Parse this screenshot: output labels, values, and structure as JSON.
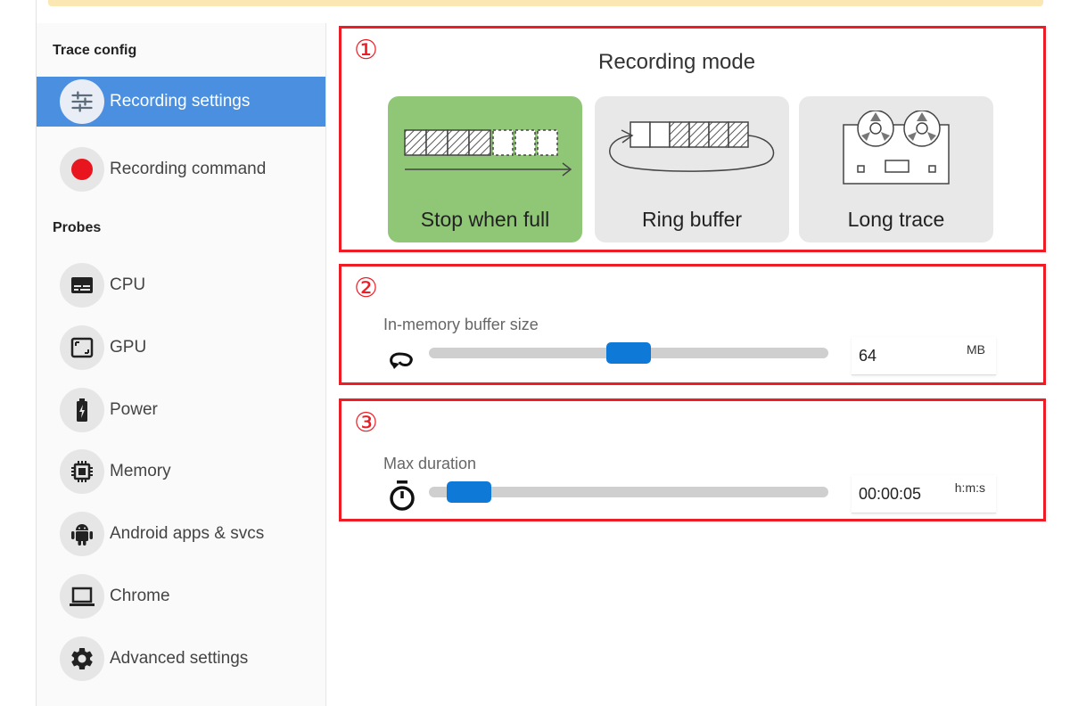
{
  "sidebar": {
    "trace_config_title": "Trace config",
    "probes_title": "Probes",
    "nav": [
      {
        "label": "Recording settings",
        "icon": "sliders-icon",
        "active": true
      },
      {
        "label": "Recording command",
        "icon": "record-dot-icon",
        "active": false
      }
    ],
    "probes": [
      {
        "label": "CPU",
        "icon": "cpu-icon"
      },
      {
        "label": "GPU",
        "icon": "gpu-icon"
      },
      {
        "label": "Power",
        "icon": "battery-icon"
      },
      {
        "label": "Memory",
        "icon": "memory-chip-icon"
      },
      {
        "label": "Android apps & svcs",
        "icon": "android-icon"
      },
      {
        "label": "Chrome",
        "icon": "laptop-icon"
      },
      {
        "label": "Advanced settings",
        "icon": "gear-icon"
      }
    ]
  },
  "annotations": [
    "①",
    "②",
    "③"
  ],
  "recording_mode": {
    "title": "Recording mode",
    "options": [
      {
        "label": "Stop when full",
        "selected": true
      },
      {
        "label": "Ring buffer",
        "selected": false
      },
      {
        "label": "Long trace",
        "selected": false
      }
    ]
  },
  "buffer": {
    "label": "In-memory buffer size",
    "value": "64",
    "unit": "MB",
    "icon": "loop-arrow-icon",
    "slider_level": 0.5
  },
  "duration": {
    "label": "Max duration",
    "value": "00:00:05",
    "unit": "h:m:s",
    "icon": "stopwatch-icon",
    "slider_level": 0.05
  },
  "colors": {
    "accent": "#0f79d8",
    "active_nav": "#4a8fe0",
    "selected_mode": "#8fc776",
    "annotation": "#ee1c25",
    "banner": "#fbe7b1"
  }
}
